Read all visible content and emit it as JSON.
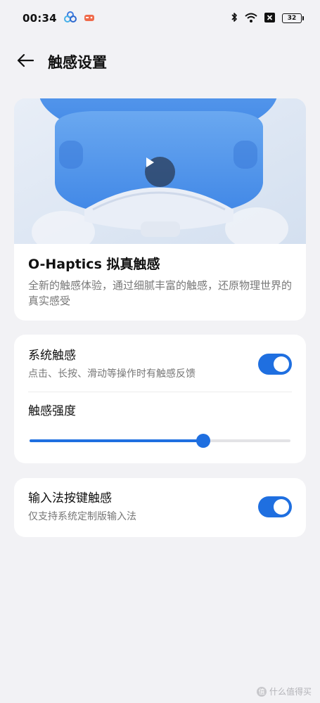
{
  "status_bar": {
    "time": "00:34",
    "battery": "32",
    "icons": [
      "cloud-app-icon",
      "game-app-icon",
      "bluetooth-icon",
      "wifi-icon",
      "sim-off-icon",
      "battery-icon"
    ]
  },
  "header": {
    "title": "触感设置",
    "back_icon": "arrow-left-icon"
  },
  "hero": {
    "title": "O-Haptics 拟真触感",
    "description": "全新的触感体验，通过细腻丰富的触感，还原物理世界的真实感受",
    "play_icon": "play-icon"
  },
  "system_haptics": {
    "title": "系统触感",
    "subtitle": "点击、长按、滑动等操作时有触感反馈",
    "enabled": true,
    "intensity_label": "触感强度",
    "intensity_fraction": 0.665
  },
  "ime_haptics": {
    "title": "输入法按键触感",
    "subtitle": "仅支持系统定制版输入法",
    "enabled": true
  },
  "watermark": {
    "logo": "值",
    "text": "什么值得买"
  },
  "colors": {
    "accent": "#1f6fe0",
    "background": "#f2f2f5",
    "card": "#ffffff",
    "secondary_text": "#777777"
  }
}
